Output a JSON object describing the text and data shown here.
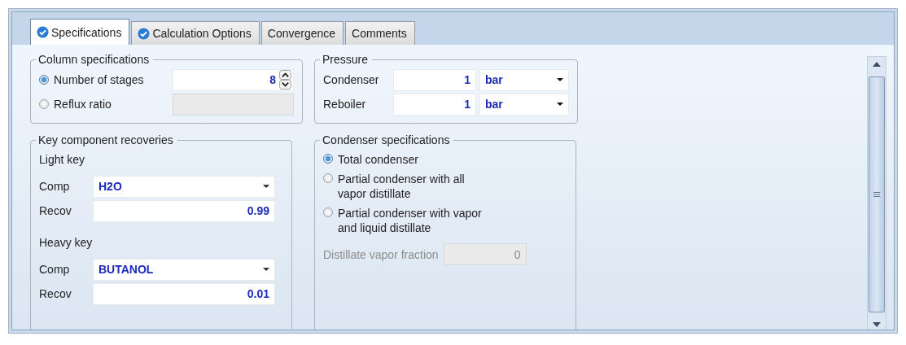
{
  "tabs": [
    {
      "label": "Specifications",
      "selected": true,
      "complete": true
    },
    {
      "label": "Calculation Options",
      "selected": false,
      "complete": true
    },
    {
      "label": "Convergence",
      "selected": false,
      "complete": false
    },
    {
      "label": "Comments",
      "selected": false,
      "complete": false
    }
  ],
  "column_specifications": {
    "title": "Column specifications",
    "options": [
      {
        "label": "Number of stages",
        "selected": true,
        "value": "8",
        "disabled": false,
        "kind": "spinner"
      },
      {
        "label": "Reflux ratio",
        "selected": false,
        "disabled": true,
        "kind": "plain"
      }
    ]
  },
  "pressure": {
    "title": "Pressure",
    "rows": [
      {
        "label": "Condenser",
        "value": "1",
        "unit": "bar"
      },
      {
        "label": "Reboiler",
        "value": "1",
        "unit": "bar"
      }
    ]
  },
  "key_component_recoveries": {
    "title": "Key component recoveries",
    "keys": [
      {
        "heading": "Light key",
        "comp_label": "Comp",
        "comp": "H2O",
        "recov_label": "Recov",
        "recov": "0.99"
      },
      {
        "heading": "Heavy key",
        "comp_label": "Comp",
        "comp": "BUTANOL",
        "recov_label": "Recov",
        "recov": "0.01"
      }
    ]
  },
  "condenser_specifications": {
    "title": "Condenser specifications",
    "options": [
      {
        "label": "Total condenser",
        "selected": true
      },
      {
        "label": "Partial condenser with all\nvapor distillate",
        "selected": false
      },
      {
        "label": "Partial condenser with vapor\nand liquid distillate",
        "selected": false
      }
    ],
    "vapor_fraction": {
      "label": "Distillate vapor fraction",
      "value": "0",
      "disabled": true
    }
  }
}
